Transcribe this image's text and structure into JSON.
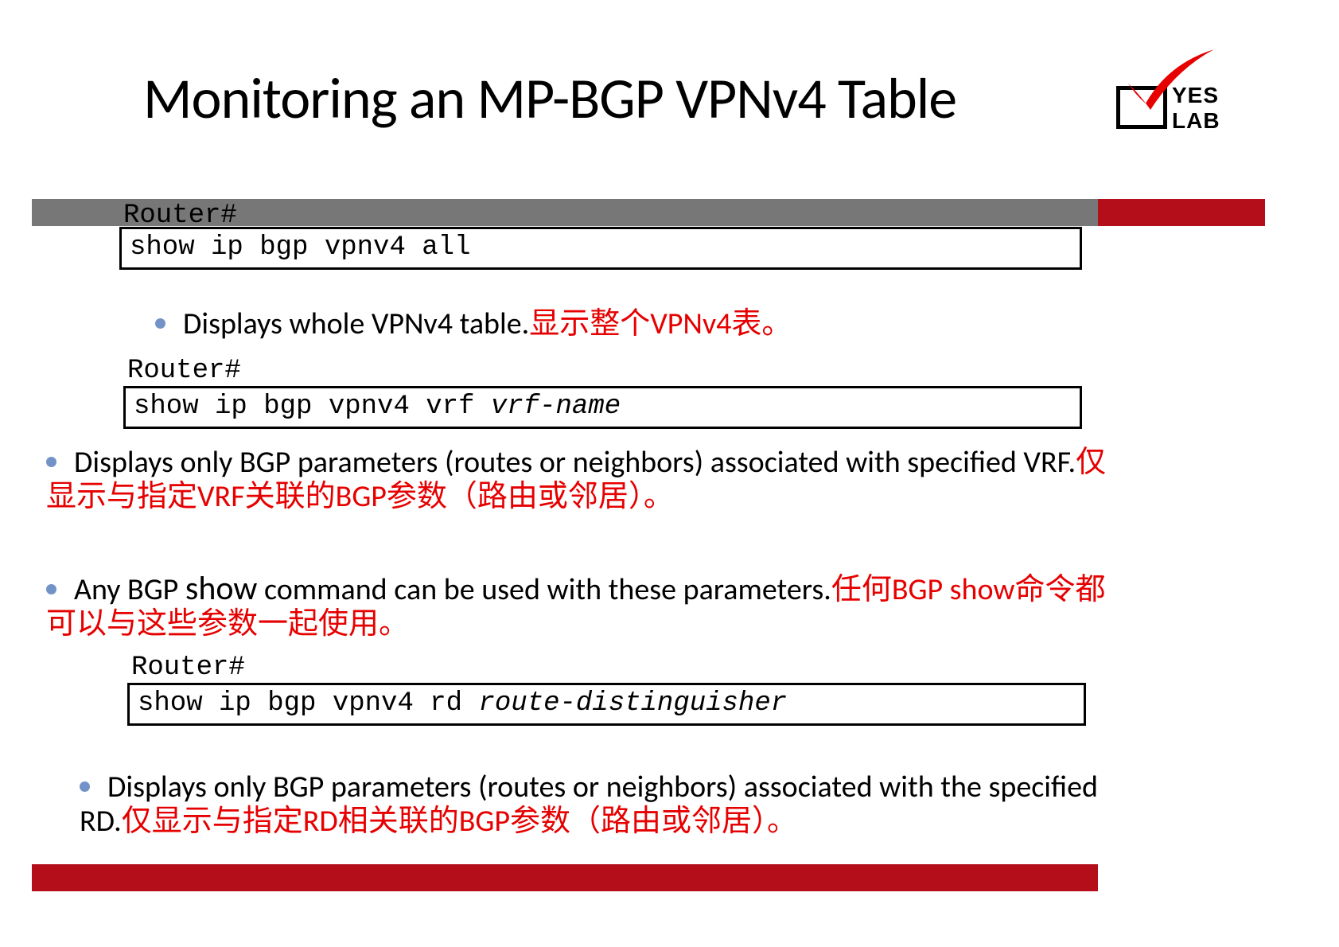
{
  "title": "Monitoring an MP-BGP VPNv4 Table",
  "logo": {
    "text": "YES LAB"
  },
  "prompts": {
    "p1": "Router#",
    "p2": "Router#",
    "p3": "Router#"
  },
  "commands": {
    "c1": "show ip bgp vpnv4 all",
    "c2_pre": "show ip bgp vpnv4 vrf ",
    "c2_arg": "vrf-name",
    "c3_pre": "show ip bgp vpnv4 rd ",
    "c3_arg": "route-distinguisher"
  },
  "bullets": {
    "b1_en": "Displays whole VPNv4 table.",
    "b1_zh": "显示整个VPNv4表。",
    "b2_en": "Displays only BGP parameters (routes or neighbors) associated with specified VRF.",
    "b2_zh": "仅显示与指定VRF关联的BGP参数（路由或邻居）。",
    "b3_en_a": "Any BGP ",
    "b3_show": "show",
    "b3_en_b": " command can be used with these parameters.",
    "b3_zh": "任何BGP show命令都可以与这些参数一起使用。",
    "b4_en": "Displays only BGP parameters (routes or neighbors)  associated with the specified RD.",
    "b4_zh": "仅显示与指定RD相关联的BGP参数（路由或邻居）。"
  }
}
